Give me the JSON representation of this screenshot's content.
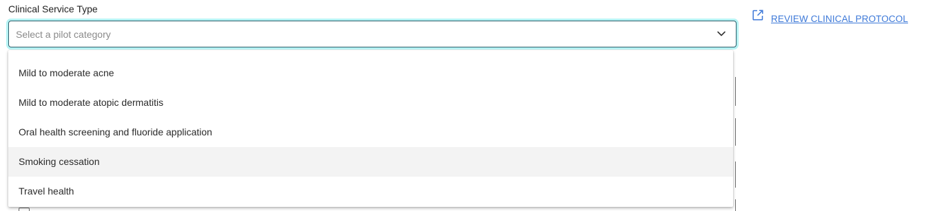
{
  "field": {
    "label": "Clinical Service Type",
    "placeholder": "Select a pilot category"
  },
  "link": {
    "icon": "external-link-icon",
    "label": "REVIEW CLINICAL PROTOCOL"
  },
  "dropdown": {
    "open": true,
    "highlighted_index": 3,
    "options": [
      {
        "label": "Mild to moderate acne"
      },
      {
        "label": "Mild to moderate atopic dermatitis"
      },
      {
        "label": "Oral health screening and fluoride application"
      },
      {
        "label": "Smoking cessation"
      },
      {
        "label": "Travel health"
      }
    ]
  },
  "colors": {
    "focus_ring": "#b6f3f4",
    "select_border": "#2b5d6a",
    "link": "#3c78d8",
    "highlight_row": "#f3f3f3"
  }
}
